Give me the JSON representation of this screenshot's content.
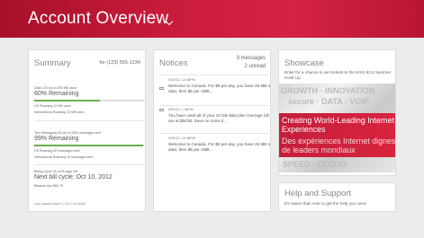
{
  "header": {
    "title": "Account Overview"
  },
  "summary": {
    "title": "Summary",
    "phone": "for (123) 555-1234",
    "data": {
      "usage": "Data 125 out of 250 MB used",
      "remaining": "60% Remaining",
      "remaining_pct": 60,
      "us_roaming": "US Roaming 10 MB used",
      "intl_roaming": "International Roaming 10 MB used"
    },
    "text": {
      "usage": "Text Messaging 25 out of 2500 messages sent",
      "remaining": "99% Remaining",
      "remaining_pct": 99,
      "us_roaming": "US Roaming 50 messages sent",
      "intl_roaming": "International Roaming 10 messages sent"
    },
    "billing": {
      "cycle": "Billing Cycle 25 of 26 days left",
      "next": "Next bill cycle: Oct 10, 2012",
      "balance": "Balance due $84.75"
    },
    "last_updated": "Last updated April 9, 2012 09:42AM"
  },
  "notices": {
    "title": "Notices",
    "count": "3 messages",
    "unread": "2 unread",
    "items": [
      {
        "date": "9/25/12, 12:48PM",
        "text": "Welcome to Canada. For $5 per day, you have 25 MB of data, then $5 per 1MB..."
      },
      {
        "date": "9/02/12, 1:36PM",
        "text": "You have used all of your 10 GB data plan Overage bill are at $5/GB. Save on more d..."
      },
      {
        "date": "9/25/12, 12:48PM",
        "text": "Welcome to Canada. For $5 per day, you have 25 MB of data, then $5 per 1MB..."
      }
    ]
  },
  "showcase": {
    "title": "Showcase",
    "text": "Enter for a chance to win tickets to the KiSS 92.5 Summer Hook Up",
    "promo_en": "Creating World-Leading Internet Experiences",
    "promo_fr": "Des expériences Internet dignes de leaders mondiaux"
  },
  "help": {
    "title": "Help and Support",
    "text": "It's easier than ever to get the help you need"
  },
  "colors": {
    "accent": "#cc1d3d",
    "bar_fill": "#6ab04c"
  }
}
